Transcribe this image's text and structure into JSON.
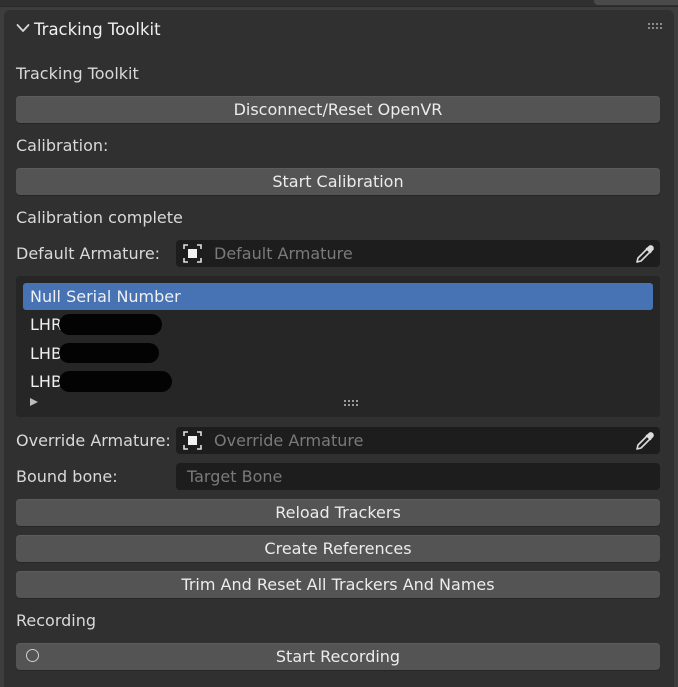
{
  "panel": {
    "title": "Tracking Toolkit",
    "header_icon": "chevron-down-icon",
    "drag_icon": "grip-dots-icon"
  },
  "section_label": "Tracking Toolkit",
  "buttons": {
    "disconnect": "Disconnect/Reset OpenVR",
    "start_calibration": "Start Calibration",
    "reload_trackers": "Reload Trackers",
    "create_references": "Create References",
    "trim_reset": "Trim And Reset All Trackers And Names",
    "start_recording": "Start Recording"
  },
  "calibration": {
    "label": "Calibration:",
    "status": "Calibration complete"
  },
  "default_armature": {
    "label": "Default Armature:",
    "placeholder": "Default Armature",
    "icon": "object-icon",
    "picker_icon": "eyedropper-icon"
  },
  "tracker_list": {
    "items": [
      {
        "label": "Null Serial Number",
        "selected": true
      },
      {
        "label": "LHR",
        "selected": false
      },
      {
        "label": "LHB",
        "selected": false
      },
      {
        "label": "LHB",
        "selected": false
      }
    ],
    "expand_icon": "triangle-right-icon",
    "resize_icon": "grip-dots-icon"
  },
  "override_armature": {
    "label": "Override Armature:",
    "placeholder": "Override Armature",
    "icon": "object-icon",
    "picker_icon": "eyedropper-icon"
  },
  "bound_bone": {
    "label": "Bound bone:",
    "placeholder": "Target Bone"
  },
  "recording": {
    "label": "Recording",
    "icon": "record-circle-icon"
  },
  "colors": {
    "background": "#303030",
    "button": "#545454",
    "field": "#1d1d1d",
    "selection": "#4772b3"
  }
}
